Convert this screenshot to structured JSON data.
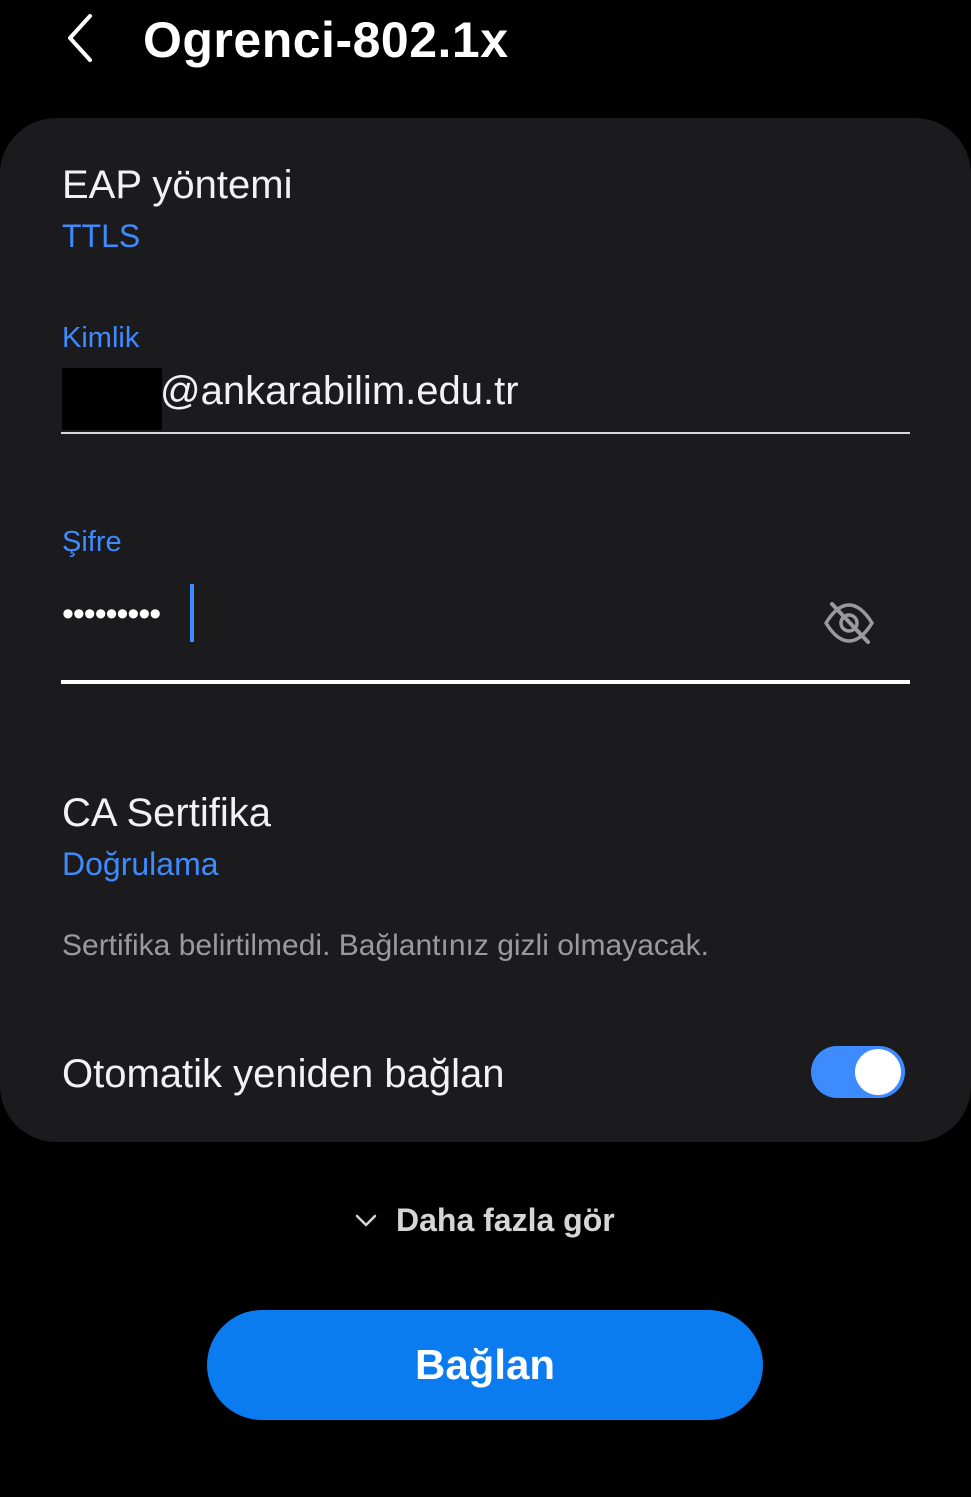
{
  "header": {
    "title": "Ogrenci-802.1x",
    "back_icon": "chevron-left-icon"
  },
  "eap": {
    "label": "EAP yöntemi",
    "value": "TTLS"
  },
  "identity": {
    "label": "Kimlik",
    "value": "@ankarabilim.edu.tr"
  },
  "password": {
    "label": "Şifre",
    "value": "•••••••••",
    "visibility_icon": "eye-off-icon"
  },
  "ca_certificate": {
    "label": "CA Sertifika",
    "value": "Doğrulama",
    "warning": "Sertifika belirtilmedi. Bağlantınız gizli olmayacak."
  },
  "auto_reconnect": {
    "label": "Otomatik yeniden bağlan",
    "enabled": true
  },
  "more": {
    "label": "Daha fazla gör",
    "icon": "chevron-down-icon"
  },
  "connect": {
    "label": "Bağlan"
  },
  "colors": {
    "accent": "#3d8bff",
    "button": "#0b7bf0",
    "card": "#1b1b1d",
    "background": "#000000"
  }
}
